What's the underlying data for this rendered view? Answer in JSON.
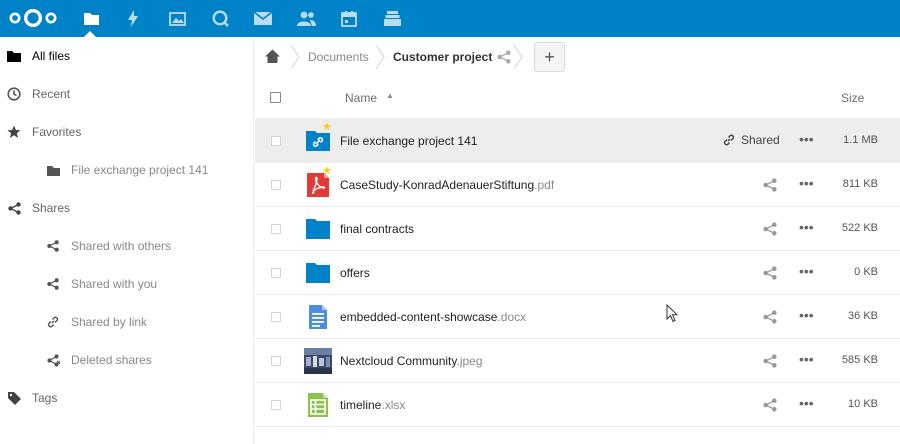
{
  "header": {
    "apps": [
      {
        "icon": "files-icon",
        "active": true
      },
      {
        "icon": "activity-icon"
      },
      {
        "icon": "gallery-icon"
      },
      {
        "icon": "talk-icon"
      },
      {
        "icon": "mail-icon"
      },
      {
        "icon": "contacts-icon"
      },
      {
        "icon": "calendar-icon"
      },
      {
        "icon": "deck-icon"
      }
    ],
    "color": "#0082c9"
  },
  "sidebar": {
    "items": [
      {
        "label": "All files",
        "icon": "folder-icon"
      },
      {
        "label": "Recent",
        "icon": "clock-icon"
      },
      {
        "label": "Favorites",
        "icon": "star-icon"
      },
      {
        "label": "File exchange project 141",
        "icon": "folder-icon"
      },
      {
        "label": "Shares",
        "icon": "share-icon"
      },
      {
        "label": "Shared with others",
        "icon": "share-icon"
      },
      {
        "label": "Shared with you",
        "icon": "share-icon"
      },
      {
        "label": "Shared by link",
        "icon": "link-icon"
      },
      {
        "label": "Deleted shares",
        "icon": "deleted-share-icon"
      },
      {
        "label": "Tags",
        "icon": "tag-icon"
      }
    ]
  },
  "breadcrumb": {
    "items": [
      "Documents",
      "Customer project"
    ],
    "add_label": "+"
  },
  "table": {
    "headers": {
      "name": "Name",
      "size": "Size"
    },
    "rows": [
      {
        "name": "File exchange project 141",
        "ext": "",
        "type": "folder-shared",
        "favorite": true,
        "shared_label": "Shared",
        "more": "•••",
        "size": "1.1 MB"
      },
      {
        "name": "CaseStudy-KonradAdenauerStiftung",
        "ext": ".pdf",
        "type": "pdf",
        "favorite": true,
        "more": "•••",
        "size": "811 KB"
      },
      {
        "name": "final contracts",
        "ext": "",
        "type": "folder",
        "favorite": false,
        "more": "•••",
        "size": "522 KB"
      },
      {
        "name": "offers",
        "ext": "",
        "type": "folder",
        "favorite": false,
        "more": "•••",
        "size": "0 KB"
      },
      {
        "name": "embedded-content-showcase",
        "ext": ".docx",
        "type": "document",
        "favorite": false,
        "more": "•••",
        "size": "36 KB"
      },
      {
        "name": "Nextcloud Community",
        "ext": ".jpeg",
        "type": "image",
        "favorite": false,
        "more": "•••",
        "size": "585 KB"
      },
      {
        "name": "timeline",
        "ext": ".xlsx",
        "type": "spreadsheet",
        "favorite": false,
        "more": "•••",
        "size": "10 KB"
      }
    ]
  },
  "colors": {
    "accent": "#0082c9",
    "favorite_star": "#ffcc00",
    "pdf_red": "#e53935",
    "spreadsheet_green": "#8bc34a",
    "document_blue": "#4c8ee6"
  }
}
